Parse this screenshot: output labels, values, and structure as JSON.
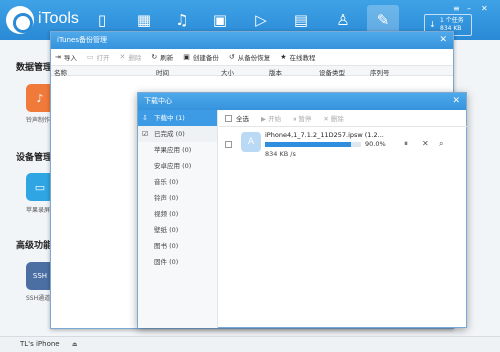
{
  "app": {
    "brand": "iTools",
    "nav_icons": [
      "phone-icon",
      "apps-icon",
      "music-icon",
      "photo-icon",
      "video-icon",
      "book-icon",
      "contacts-icon",
      "tools-icon"
    ],
    "task_count": "1 个任务",
    "task_speed": "834 KB /s",
    "accent": "#3593dd"
  },
  "sidebar": {
    "sections": [
      {
        "title": "数据管理",
        "items": [
          {
            "label": "铃声制作"
          }
        ]
      },
      {
        "title": "设备管理",
        "items": [
          {
            "label": "苹果录屏大"
          }
        ]
      },
      {
        "title": "高级功能",
        "items": [
          {
            "label": "SSH通道"
          }
        ]
      }
    ]
  },
  "backup_window": {
    "title": "iTunes备份管理",
    "toolbar": [
      "导入",
      "打开",
      "删除",
      "刷新",
      "创建备份",
      "从备份恢复",
      "在线教程"
    ],
    "columns": [
      "名称",
      "时间",
      "大小",
      "版本",
      "设备类型",
      "序列号"
    ]
  },
  "download_window": {
    "title": "下载中心",
    "categories": [
      {
        "label": "下载中 (1)"
      },
      {
        "label": "已完成 (0)"
      },
      {
        "label": "苹果应用 (0)"
      },
      {
        "label": "安卓应用 (0)"
      },
      {
        "label": "音乐 (0)"
      },
      {
        "label": "铃声 (0)"
      },
      {
        "label": "视频 (0)"
      },
      {
        "label": "壁纸 (0)"
      },
      {
        "label": "图书 (0)"
      },
      {
        "label": "固件 (0)"
      }
    ],
    "toolbar": [
      "全选",
      "开始",
      "暂停",
      "删除"
    ],
    "item": {
      "filename": "iPhone4,1_7.1.2_11D257.ipsw (1.2...",
      "percent": "90.0%",
      "progress": 0.9,
      "speed": "834 KB /s"
    }
  },
  "statusbar": {
    "device": "TL's iPhone"
  }
}
